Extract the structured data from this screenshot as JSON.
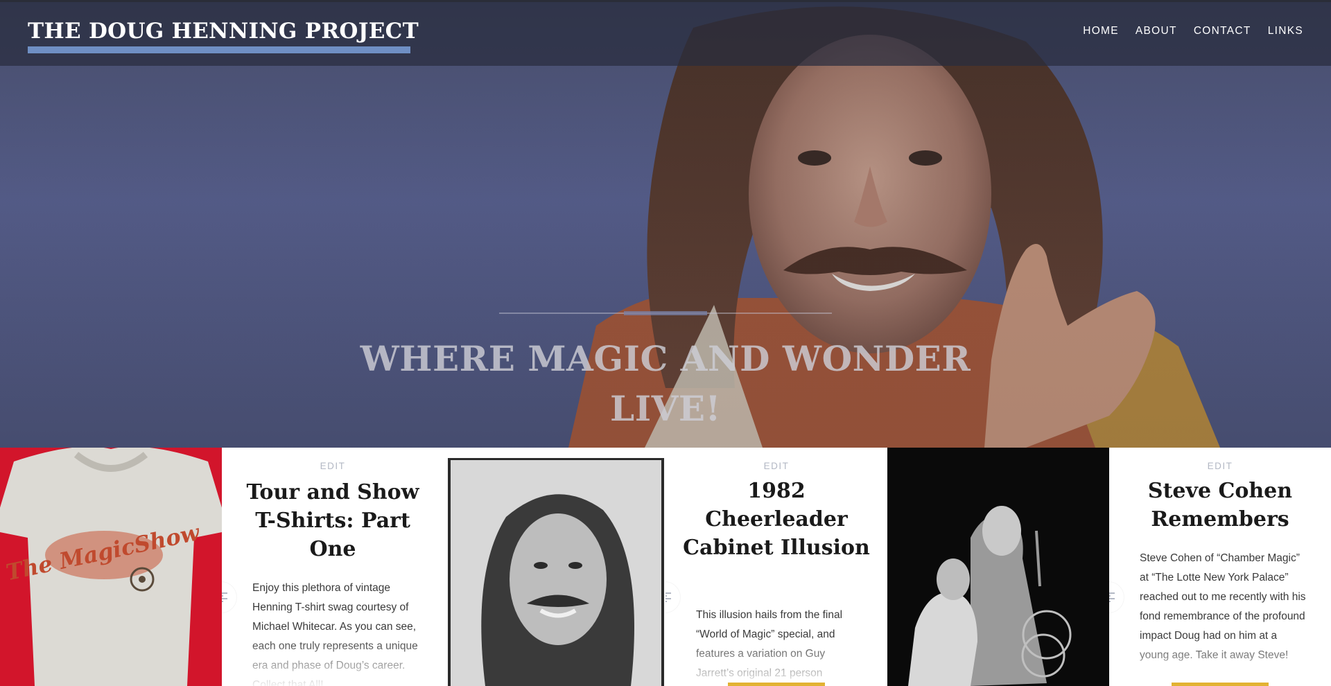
{
  "site": {
    "title": "THE DOUG HENNING PROJECT",
    "accent_color": "#6f8fc4"
  },
  "nav": {
    "items": [
      {
        "label": "HOME"
      },
      {
        "label": "ABOUT"
      },
      {
        "label": "CONTACT"
      },
      {
        "label": "LINKS"
      }
    ]
  },
  "hero": {
    "tagline": "WHERE MAGIC AND WONDER LIVE!",
    "image": "portrait-of-smiling-magician-photo"
  },
  "posts": [
    {
      "edit_label": "EDIT",
      "title": "Tour and Show T-Shirts: Part One",
      "excerpt": "Enjoy this plethora of vintage Henning T-shirt swag courtesy of Michael Whitecar. As you can see, each one truly represents a unique era and phase of Doug’s career. Collect that All!",
      "thumbnail": "vintage-t-shirt-photo",
      "shirt_logo": "The MagicShow",
      "format_icon": "standard-post-format-icon"
    },
    {
      "edit_label": "EDIT",
      "title": "1982 Cheerleader Cabinet Illusion",
      "excerpt": "This illusion hails from the final “World of Magic” special, and features a variation on Guy Jarrett’s original 21 person",
      "thumbnail": "black-and-white-portrait-photo",
      "format_icon": "standard-post-format-icon"
    },
    {
      "edit_label": "EDIT",
      "title": "Steve Cohen Remembers",
      "excerpt": "Steve Cohen of  “Chamber Magic” at “The Lotte New York Palace” reached out to me recently with his fond remembrance of the profound impact Doug had on him at a young age. Take it away Steve!",
      "thumbnail": "stage-performance-photo",
      "format_icon": "standard-post-format-icon"
    }
  ],
  "colors": {
    "read_more_accent": "#e2b233",
    "edit_link": "#b3b8c4"
  }
}
